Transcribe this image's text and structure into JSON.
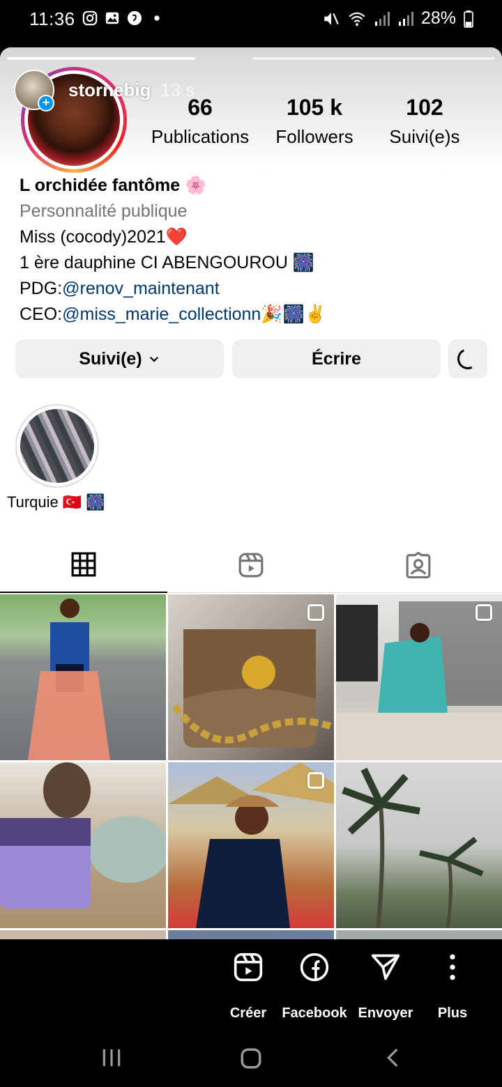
{
  "status_bar": {
    "time": "11:36",
    "battery": "28%",
    "left_icons": [
      "instagram-icon",
      "gallery-icon",
      "shazam-icon",
      "dot-icon"
    ],
    "right_icons": [
      "mute-icon",
      "wifi-icon",
      "signal-icon",
      "signal-icon",
      "battery-icon"
    ]
  },
  "story": {
    "username": "stornebig",
    "time_ago": "13 s"
  },
  "profile": {
    "stats": [
      {
        "value": "66",
        "label": "Publications"
      },
      {
        "value": "105 k",
        "label": "Followers"
      },
      {
        "value": "102",
        "label": "Suivi(e)s"
      }
    ],
    "name": "L orchidée fantôme 🌸",
    "category": "Personnalité publique",
    "bio_line1": "Miss  (cocody)2021❤️",
    "bio_line2": "1 ère dauphine CI ABENGOUROU 🎆",
    "bio_line3_prefix": "PDG:",
    "bio_line3_link": "@renov_maintenant",
    "bio_line4_prefix": "CEO:",
    "bio_line4_link": "@miss_marie_collectionn",
    "bio_line4_suffix": "🎉🎆✌️"
  },
  "buttons": {
    "follow": "Suivi(e)",
    "message": "Écrire"
  },
  "highlights": [
    {
      "label": "Turquie 🇹🇷 🎆"
    }
  ],
  "tabs": [
    "grid-icon",
    "reels-icon",
    "tagged-icon"
  ],
  "share_sheet": [
    {
      "label": "Créer",
      "icon": "reels-create-icon"
    },
    {
      "label": "Facebook",
      "icon": "facebook-icon"
    },
    {
      "label": "Envoyer",
      "icon": "send-icon"
    },
    {
      "label": "Plus",
      "icon": "more-vertical-icon"
    }
  ],
  "colors": {
    "link": "#00376b",
    "button_bg": "#efefef",
    "badge": "#0095f6"
  }
}
